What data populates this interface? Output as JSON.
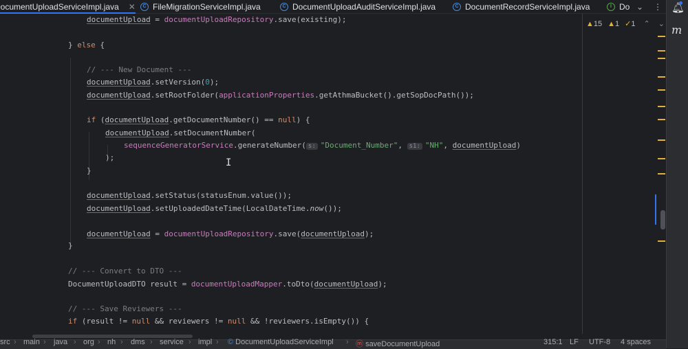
{
  "tabs": [
    {
      "label": "DocumentUploadServiceImpl.java",
      "active": true
    },
    {
      "label": "FileMigrationServiceImpl.java",
      "active": false
    },
    {
      "label": "DocumentUploadAuditServiceImpl.java",
      "active": false
    },
    {
      "label": "DocumentRecordServiceImpl.java",
      "active": false
    },
    {
      "label": "Do",
      "active": false
    }
  ],
  "tab_controls": {
    "chevron": "⌄",
    "more": "⋮"
  },
  "inspection": {
    "warnings": "15",
    "weak_warnings": "1",
    "typos": "1"
  },
  "right_toolbar": {
    "notifications_icon": "bell-icon",
    "plugin_label": "m"
  },
  "code": {
    "l1": {
      "a": "documentUpload",
      "b": " = ",
      "c": "documentUploadRepository",
      "d": ".save(existing);"
    },
    "l2": {
      "a": "} ",
      "b": "else",
      "c": " {"
    },
    "l3": {
      "a": "// --- New Document ---"
    },
    "l4": {
      "a": "documentUpload",
      "b": ".setVersion(",
      "c": "0",
      "d": ");"
    },
    "l5": {
      "a": "documentUpload",
      "b": ".setRootFolder(",
      "c": "applicationProperties",
      "d": ".getAthmaBucket().getSopDocPath());"
    },
    "l6": {
      "a": "if",
      "b": " (",
      "c": "documentUpload",
      "d": ".getDocumentNumber() == ",
      "e": "null",
      "f": ") {"
    },
    "l7": {
      "a": "documentUpload",
      "b": ".setDocumentNumber("
    },
    "l8": {
      "a": "sequenceGeneratorService",
      "b": ".generateNumber(",
      "h1": "s:",
      "c": "\"Document_Number\"",
      "d": ", ",
      "h2": "s1:",
      "e": "\"NH\"",
      "f": ", ",
      "g": "documentUpload",
      "i": ")"
    },
    "l9": {
      "a": ");"
    },
    "l10": {
      "a": "}"
    },
    "l11": {
      "a": "documentUpload",
      "b": ".setStatus(statusEnum.value());"
    },
    "l12": {
      "a": "documentUpload",
      "b": ".setUploadedDateTime(LocalDateTime.",
      "c": "now",
      "d": "());"
    },
    "l13": {
      "a": "documentUpload",
      "b": " = ",
      "c": "documentUploadRepository",
      "d": ".save(",
      "e": "documentUpload",
      "f": ");"
    },
    "l14": {
      "a": "}"
    },
    "l15": {
      "a": "// --- Convert to DTO ---"
    },
    "l16": {
      "a": "DocumentUploadDTO result = ",
      "b": "documentUploadMapper",
      "c": ".toDto(",
      "d": "documentUpload",
      "e": ");"
    },
    "l17": {
      "a": "// --- Save Reviewers ---"
    },
    "l18": {
      "a": "if",
      "b": " (result != ",
      "c": "null",
      "d": " && reviewers != ",
      "e": "null",
      "f": " && !reviewers.isEmpty()) {"
    }
  },
  "status": {
    "breadcrumb": [
      "src",
      "main",
      "java",
      "org",
      "nh",
      "dms",
      "service",
      "impl",
      "DocumentUploadServiceImpl",
      "saveDocumentUpload"
    ],
    "position": "315:1",
    "line_sep": "LF",
    "encoding": "UTF-8",
    "indent": "4 spaces"
  },
  "colors": {
    "accent": "#3574f0",
    "background": "#1e1f22",
    "keyword": "#cf8e6d",
    "field": "#c77dbb",
    "string": "#6aab73",
    "comment": "#7a7e85",
    "number": "#2aacb8"
  }
}
